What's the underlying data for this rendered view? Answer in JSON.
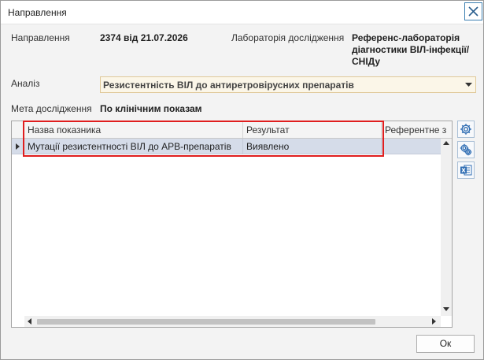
{
  "window": {
    "title": "Направлення",
    "close_icon": "close-icon"
  },
  "form": {
    "direction_label": "Направлення",
    "direction_value": "2374 від 21.07.2026",
    "lab_label": "Лабораторія дослідження",
    "lab_value": "Референс-лабораторія діагностики ВІЛ-інфекції/СНІДу",
    "analysis_label": "Аналіз",
    "analysis_value": "Резистентність ВІЛ до антиретровірусних препаратів",
    "purpose_label": "Мета дослідження",
    "purpose_value": "По клінічним показам"
  },
  "grid": {
    "columns": [
      "Назва показника",
      "Результат",
      "Референтне з"
    ],
    "rows": [
      {
        "indicator": "Мутації резистентності ВІЛ до АРВ-препаратів",
        "result": "Виявлено"
      }
    ]
  },
  "side_buttons": {
    "settings_icon": "gear-icon",
    "settings_all_icon": "gears-icon",
    "excel_icon": "excel-icon"
  },
  "footer": {
    "ok_label": "Ок"
  },
  "colors": {
    "selected_row": "#d5dce9",
    "highlight": "#e01e1e",
    "combo_bg": "#fbf6e8"
  }
}
